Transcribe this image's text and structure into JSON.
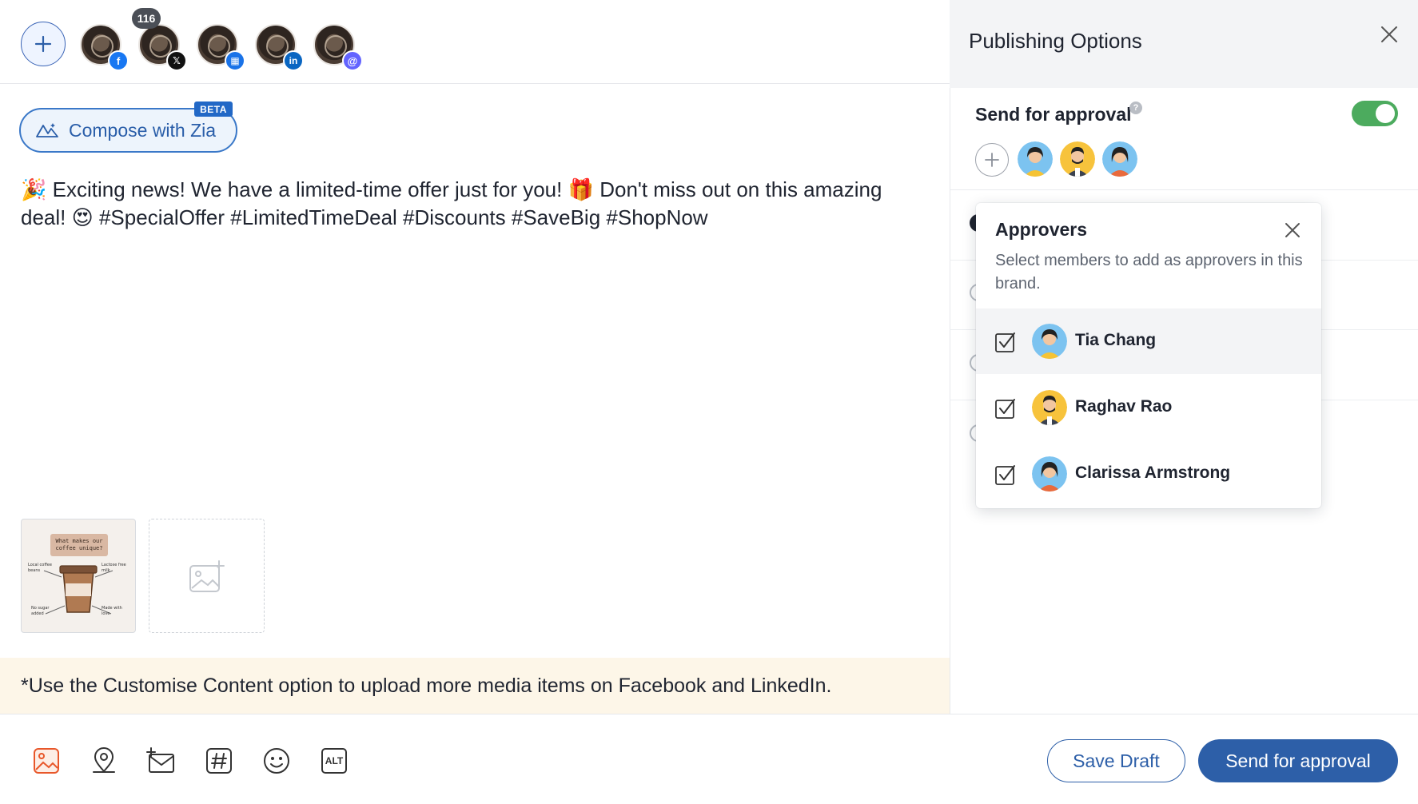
{
  "channels": {
    "add_label": "+",
    "notification_count": "116",
    "accounts": [
      {
        "network": "facebook",
        "badge_color": "#1877f2",
        "badge_glyph": "f"
      },
      {
        "network": "x",
        "badge_color": "#111111",
        "badge_glyph": "𝕏"
      },
      {
        "network": "google-business",
        "badge_color": "#1a73e8",
        "badge_glyph": "▦"
      },
      {
        "network": "linkedin",
        "badge_color": "#0a66c2",
        "badge_glyph": "in"
      },
      {
        "network": "mastodon",
        "badge_color": "#6364ff",
        "badge_glyph": "@"
      }
    ]
  },
  "compose": {
    "zia_label": "Compose with Zia",
    "beta_label": "BETA",
    "post_text_part1": "Exciting news! We have a limited-time offer just for you!",
    "post_text_part2": "Don't miss out on this amazing deal!",
    "post_hashtags": "#SpecialOffer #LimitedTimeDeal #Discounts #SaveBig #ShopNow",
    "emoji_party": "🎉",
    "emoji_gift": "🎁",
    "emoji_heart_eyes": "😍"
  },
  "media": {
    "thumb_title": "What makes our coffee unique?",
    "thumb_notes": [
      "Local coffee beans",
      "Lactose free milk",
      "No sugar added",
      "Made with love"
    ]
  },
  "notice": "*Use the Customise Content option to upload more media items on Facebook and LinkedIn.",
  "toolbar": {
    "icons": [
      "image-icon",
      "location-icon",
      "mail-add-icon",
      "hashtag-icon",
      "emoji-icon",
      "alt-text-icon"
    ],
    "alt_label": "ALT",
    "save_draft_label": "Save Draft",
    "send_for_approval_label": "Send for approval"
  },
  "panel": {
    "title": "Publishing Options",
    "send_for_approval_label": "Send for approval",
    "help_glyph": "?",
    "approval_enabled": true,
    "toggle_color": "#4cab5e"
  },
  "approvers_popup": {
    "title": "Approvers",
    "description": "Select members to add as approvers in this brand.",
    "members": [
      {
        "name": "Tia Chang",
        "checked": true
      },
      {
        "name": "Raghav Rao",
        "checked": true
      },
      {
        "name": "Clarissa Armstrong",
        "checked": true
      }
    ]
  },
  "colors": {
    "brand_blue": "#2d5fa8",
    "notice_bg": "#fdf6e8",
    "accent_orange": "#e8572a"
  }
}
